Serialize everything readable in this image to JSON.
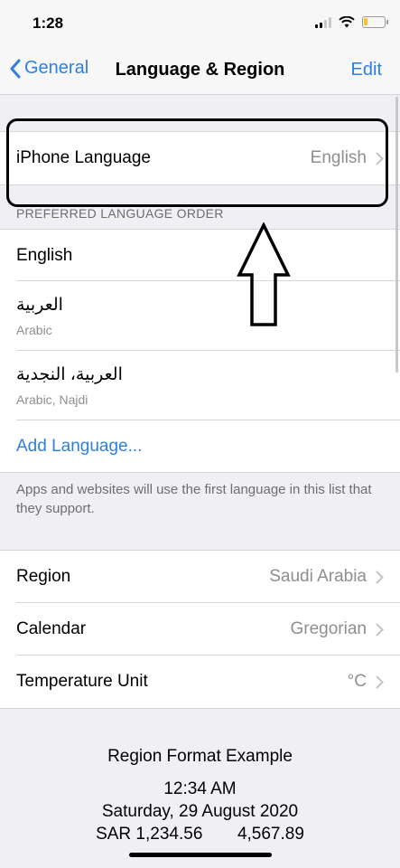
{
  "status": {
    "time": "1:28"
  },
  "nav": {
    "back_label": "General",
    "title": "Language & Region",
    "edit_label": "Edit"
  },
  "iphone_language": {
    "label": "iPhone Language",
    "value": "English"
  },
  "preferred": {
    "header": "PREFERRED LANGUAGE ORDER",
    "items": [
      {
        "main": "English",
        "sub": ""
      },
      {
        "main": "العربية",
        "sub": "Arabic"
      },
      {
        "main": "العربية، النجدية",
        "sub": "Arabic, Najdi"
      }
    ],
    "add_label": "Add Language...",
    "footer": "Apps and websites will use the first language in this list that they support."
  },
  "settings": [
    {
      "label": "Region",
      "value": "Saudi Arabia"
    },
    {
      "label": "Calendar",
      "value": "Gregorian"
    },
    {
      "label": "Temperature Unit",
      "value": "°C"
    }
  ],
  "example": {
    "title": "Region Format Example",
    "time": "12:34 AM",
    "date": "Saturday, 29 August 2020",
    "currency": "SAR 1,234.56",
    "number": "4,567.89"
  },
  "colors": {
    "accent": "#2f7fe2",
    "background": "#efeff4",
    "secondary_text": "#8e8e93"
  },
  "icons": [
    "signal-icon",
    "wifi-icon",
    "battery-icon",
    "back-chevron-icon",
    "chevron-right-icon",
    "up-arrow-annotation-icon"
  ]
}
